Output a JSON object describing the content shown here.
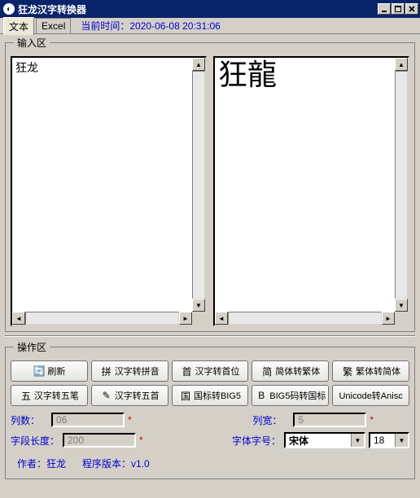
{
  "window": {
    "title": "狂龙汉字转换器"
  },
  "tabs": {
    "text": "文本",
    "excel": "Excel"
  },
  "time": {
    "label": "当前时间：",
    "value": "2020-06-08  20:31:06"
  },
  "input_area": {
    "legend": "输入区",
    "left_value": "狂龙",
    "right_value": "狂龍"
  },
  "ops_area": {
    "legend": "操作区",
    "buttons": {
      "refresh": "刷新",
      "to_pinyin": "汉字转拼音",
      "to_shouwei": "汉字转首位",
      "simp_to_trad": "简体转繁体",
      "trad_to_simp": "繁体转简体",
      "to_wubi": "汉字转五笔",
      "to_wushou": "汉字转五首",
      "gb_to_big5": "国标转BIG5",
      "big5_to_gb": "BIG5码转国标",
      "unicode_to_anisc": "Unicode转Anisc"
    }
  },
  "form": {
    "col_count": {
      "label": "列数：",
      "value": "06",
      "star": "*"
    },
    "col_width": {
      "label": "列宽：",
      "value": "5",
      "star": "*"
    },
    "field_len": {
      "label": "字段长度：",
      "value": "200",
      "star": "*"
    },
    "font_name": {
      "label": "字体字号：",
      "value": "宋体"
    },
    "font_size": {
      "value": "18"
    }
  },
  "footer": {
    "author_label": "作者：",
    "author_value": "狂龙",
    "version_label": "程序版本：",
    "version_value": "v1.0"
  }
}
